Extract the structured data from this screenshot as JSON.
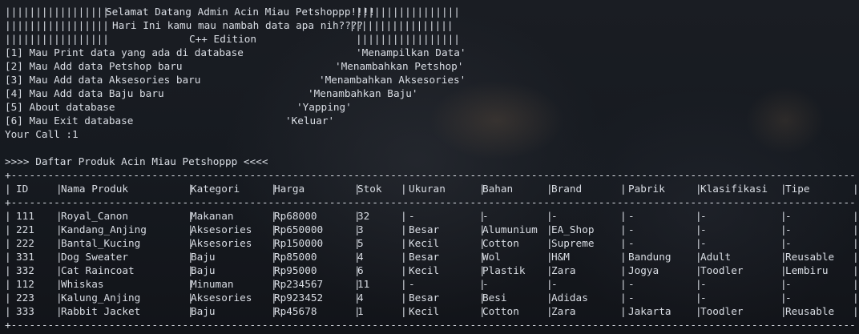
{
  "banner": [
    {
      "left": "||||||||||||||||| ",
      "middle": "Selamat Datang Admin Acin Miau Petshoppp!!!!",
      "right": "|||||||||||||||||"
    },
    {
      "left": "|||||||||||||||||  ",
      "middle": "Hari Ini kamu mau nambah data apa nih????",
      "right": " |||||||||||||||||"
    },
    {
      "left": "|||||||||||||||||",
      "middle": "C++ Edition",
      "right": "|||||||||||||||||"
    }
  ],
  "menu": [
    {
      "label": "[1] Mau Print data yang ada di database",
      "desc": "'Menampilkan Data'"
    },
    {
      "label": "[2] Mau Add data Petshop baru",
      "desc": "'Menambahkan Petshop'"
    },
    {
      "label": "[3] Mau Add data Aksesories baru",
      "desc": "'Menambahkan Aksesories'"
    },
    {
      "label": "[4] Mau Add data Baju baru",
      "desc": "'Menambahkan Baju'"
    },
    {
      "label": "[5] About database",
      "desc": "'Yapping'"
    },
    {
      "label": "[6] Mau Exit database",
      "desc": "'Keluar'"
    }
  ],
  "prompt": {
    "label": "Your Call : ",
    "value": "1"
  },
  "list_title": ">>>> Daftar Produk Acin Miau Petshoppp <<<<",
  "table": {
    "columns": [
      "ID",
      "Nama Produk",
      "Kategori",
      "Harga",
      "Stok",
      "Ukuran",
      "Bahan",
      "Brand",
      "Pabrik",
      "Klasifikasi",
      "Tipe"
    ],
    "rows": [
      [
        "111",
        "Royal_Canon",
        "Makanan",
        "Rp68000",
        "32",
        "-",
        "-",
        "-",
        "-",
        "-",
        "-"
      ],
      [
        "221",
        "Kandang_Anjing",
        "Aksesories",
        "Rp650000",
        "3",
        "Besar",
        "Alumunium",
        "EA_Shop",
        "-",
        "-",
        "-"
      ],
      [
        "222",
        "Bantal_Kucing",
        "Aksesories",
        "Rp150000",
        "5",
        "Kecil",
        "Cotton",
        "Supreme",
        "-",
        "-",
        "-"
      ],
      [
        "331",
        "Dog Sweater",
        "Baju",
        "Rp85000",
        "4",
        "Besar",
        "Wol",
        "H&M",
        "Bandung",
        "Adult",
        "Reusable"
      ],
      [
        "332",
        "Cat Raincoat",
        "Baju",
        "Rp95000",
        "6",
        "Kecil",
        "Plastik",
        "Zara",
        "Jogya",
        "Toodler",
        "Lembiru"
      ],
      [
        "112",
        "Whiskas",
        "Minuman",
        "Rp234567",
        "11",
        "-",
        "-",
        "-",
        "-",
        "-",
        "-"
      ],
      [
        "223",
        "Kalung_Anjing",
        "Aksesories",
        "Rp923452",
        "4",
        "Besar",
        "Besi",
        "Adidas",
        "-",
        "-",
        "-"
      ],
      [
        "333",
        "Rabbit Jacket",
        "Baju",
        "Rp45678",
        "1",
        "Kecil",
        "Cotton",
        "Zara",
        "Jakarta",
        "Toodler",
        "Reusable"
      ]
    ]
  }
}
